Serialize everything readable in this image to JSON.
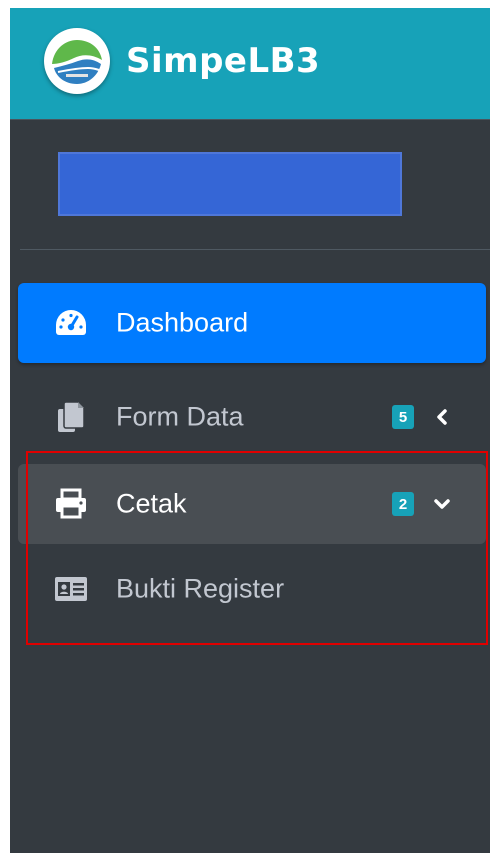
{
  "brand": {
    "title": "SimpeLB3",
    "logo_icon": "leaf-globe-logo-icon",
    "background": "#17a2b8"
  },
  "user_panel": {
    "placeholder_color": "#3566d6"
  },
  "nav": {
    "items": [
      {
        "label": "Dashboard",
        "icon": "tachometer-icon",
        "state": "active"
      },
      {
        "label": "Form Data",
        "icon": "copy-icon",
        "badge": "5",
        "chevron": "chevron-left-icon"
      },
      {
        "label": "Cetak",
        "icon": "print-icon",
        "badge": "2",
        "chevron": "chevron-down-icon",
        "state": "open"
      },
      {
        "label": "Bukti Register",
        "icon": "id-card-icon"
      }
    ]
  },
  "colors": {
    "sidebar_bg": "#343a40",
    "active_bg": "#007bff",
    "open_bg": "#494e53",
    "badge_bg": "#17a2b8",
    "text_muted": "#c2c7d0",
    "highlight_border": "#e00000"
  }
}
